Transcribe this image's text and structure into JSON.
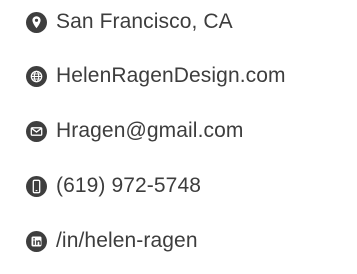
{
  "contact": {
    "location": {
      "text": "San Francisco, CA",
      "icon": "location-pin-icon"
    },
    "website": {
      "text": "HelenRagenDesign.com",
      "icon": "globe-icon"
    },
    "email": {
      "text": "Hragen@gmail.com",
      "icon": "envelope-icon"
    },
    "phone": {
      "text": "(619) 972-5748",
      "icon": "phone-icon"
    },
    "linkedin": {
      "text": "/in/helen-ragen",
      "icon": "linkedin-icon"
    }
  },
  "colors": {
    "text": "#3d3d3d",
    "icon_background": "#3e3e3e",
    "icon_foreground": "#ffffff"
  }
}
